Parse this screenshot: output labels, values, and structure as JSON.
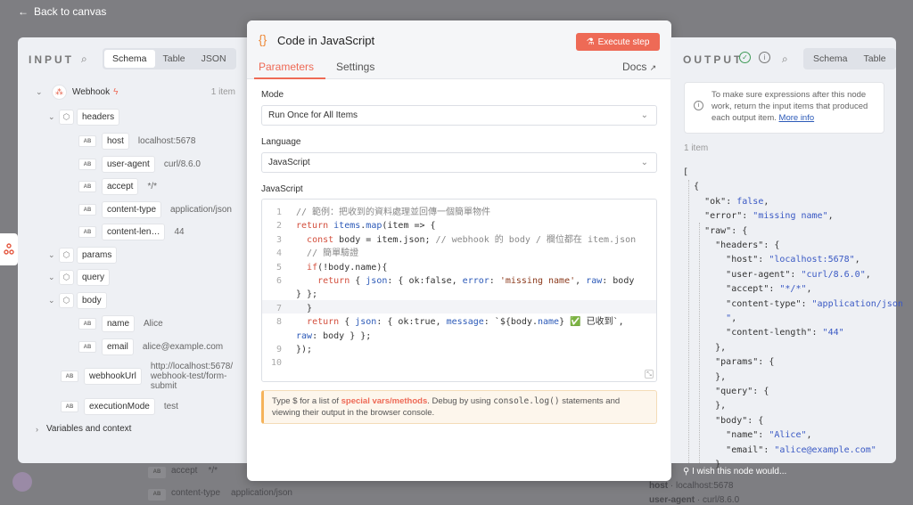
{
  "nav": {
    "back_label": "Back to canvas"
  },
  "background": {
    "rows": [
      {
        "key": "accept",
        "value": "*/*"
      },
      {
        "key": "content-type",
        "value": "application/json"
      }
    ],
    "output_rows": [
      {
        "key": "host",
        "value": "localhost:5678"
      },
      {
        "key": "user-agent",
        "value": "curl/8.6.0"
      }
    ]
  },
  "input": {
    "title": "INPUT",
    "views": [
      "Schema",
      "Table",
      "JSON"
    ],
    "active_view": "Schema",
    "node": {
      "name": "Webhook",
      "count": "1 item"
    },
    "tree": [
      {
        "key": "headers",
        "value": ""
      },
      {
        "key": "host",
        "value": "localhost:5678"
      },
      {
        "key": "user-agent",
        "value": "curl/8.6.0"
      },
      {
        "key": "accept",
        "value": "*/*"
      },
      {
        "key": "content-type",
        "value": "application/json"
      },
      {
        "key": "content-len…",
        "value": "44"
      },
      {
        "key": "params",
        "value": ""
      },
      {
        "key": "query",
        "value": ""
      },
      {
        "key": "body",
        "value": ""
      },
      {
        "key": "name",
        "value": "Alice"
      },
      {
        "key": "email",
        "value": "alice@example.com"
      },
      {
        "key": "webhookUrl",
        "value": "http://localhost:5678/ webhook-test/form- submit"
      },
      {
        "key": "executionMode",
        "value": "test"
      }
    ],
    "variables_label": "Variables and context"
  },
  "modal": {
    "icon": "{}",
    "title": "Code in JavaScript",
    "execute_label": "Execute step",
    "tabs": [
      "Parameters",
      "Settings"
    ],
    "docs_label": "Docs",
    "mode": {
      "label": "Mode",
      "value": "Run Once for All Items"
    },
    "language": {
      "label": "Language",
      "value": "JavaScript"
    },
    "code_label": "JavaScript",
    "code_lines": [
      "// 範例：把收到的資料處理並回傳一個簡單物件",
      "return items.map(item => {",
      "  const body = item.json; // webhook 的 body / 欄位都在 item.json",
      "  // 簡單驗證",
      "  if(!body.name){",
      "    return { json: { ok:false, error: 'missing name', raw: body",
      "} };",
      "  }",
      "  return { json: { ok:true, message: `${body.name} ✅ 已收到`,",
      "raw: body } };",
      "});",
      ""
    ],
    "line_numbers": [
      "1",
      "2",
      "3",
      "4",
      "5",
      "6",
      "",
      "7",
      "8",
      "",
      "9",
      "10"
    ],
    "hint_parts": {
      "a": "Type $ for a list of ",
      "link": "special vars/methods",
      "b": ". Debug by using ",
      "code": "console.log()",
      "c": " statements and viewing their output in the browser console."
    }
  },
  "output": {
    "title": "OUTPUT",
    "views": [
      "Schema",
      "Table"
    ],
    "info": "To make sure expressions after this node work, return the input items that produced each output item.",
    "info_link": "More info",
    "count": "1 item",
    "json_lines": [
      "[",
      "  {",
      "    \"ok\": false,",
      "    \"error\": \"missing name\",",
      "    \"raw\": {",
      "      \"headers\": {",
      "        \"host\": \"localhost:5678\",",
      "        \"user-agent\": \"curl/8.6.0\",",
      "        \"accept\": \"*/*\",",
      "        \"content-type\": \"application/json",
      "        \",",
      "        \"content-length\": \"44\"",
      "      },",
      "      \"params\": {",
      "      },",
      "      \"query\": {",
      "      },",
      "      \"body\": {",
      "        \"name\": \"Alice\",",
      "        \"email\": \"alice@example.com\"",
      "      }"
    ],
    "wish_label": "I wish this node would..."
  },
  "colors": {
    "accent": "#ee6a56",
    "panel": "#eef0f4"
  }
}
